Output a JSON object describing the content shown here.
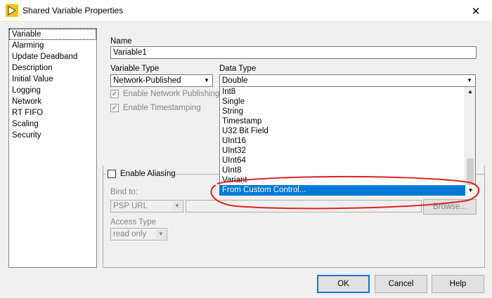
{
  "window": {
    "title": "Shared Variable Properties",
    "close_glyph": "✕"
  },
  "sidebar": {
    "items": [
      {
        "label": "Variable",
        "selected": true
      },
      {
        "label": "Alarming"
      },
      {
        "label": "Update Deadband"
      },
      {
        "label": "Description"
      },
      {
        "label": "Initial Value"
      },
      {
        "label": "Logging"
      },
      {
        "label": "Network"
      },
      {
        "label": "RT FIFO"
      },
      {
        "label": "Scaling"
      },
      {
        "label": "Security"
      }
    ]
  },
  "form": {
    "name_label": "Name",
    "name_value": "Variable1",
    "variable_type_label": "Variable Type",
    "variable_type_value": "Network-Published",
    "data_type_label": "Data Type",
    "data_type_value": "Double",
    "enable_network_publishing": {
      "label": "Enable Network Publishing",
      "checked": true,
      "enabled": false
    },
    "enable_timestamping": {
      "label": "Enable Timestamping",
      "checked": true,
      "enabled": false
    },
    "data_type_options": [
      "Int8",
      "Single",
      "String",
      "Timestamp",
      "U32 Bit Field",
      "UInt16",
      "UInt32",
      "UInt64",
      "UInt8",
      "Variant"
    ],
    "highlighted_option": "From Custom Control...",
    "enable_aliasing": {
      "label": "Enable Aliasing",
      "checked": false
    },
    "bind_to_label": "Bind to:",
    "bind_to_value": "PSP URL",
    "bind_path_value": "",
    "browse_label": "Browse...",
    "access_type_label": "Access Type",
    "access_type_value": "read only"
  },
  "footer": {
    "ok_label": "OK",
    "cancel_label": "Cancel",
    "help_label": "Help"
  },
  "colors": {
    "selection": "#0078d7",
    "annotation": "#e02020"
  },
  "icons": {
    "app": "labview-logo-icon",
    "dropdown": "chevron-down-icon",
    "checkmark": "checkmark-icon"
  }
}
